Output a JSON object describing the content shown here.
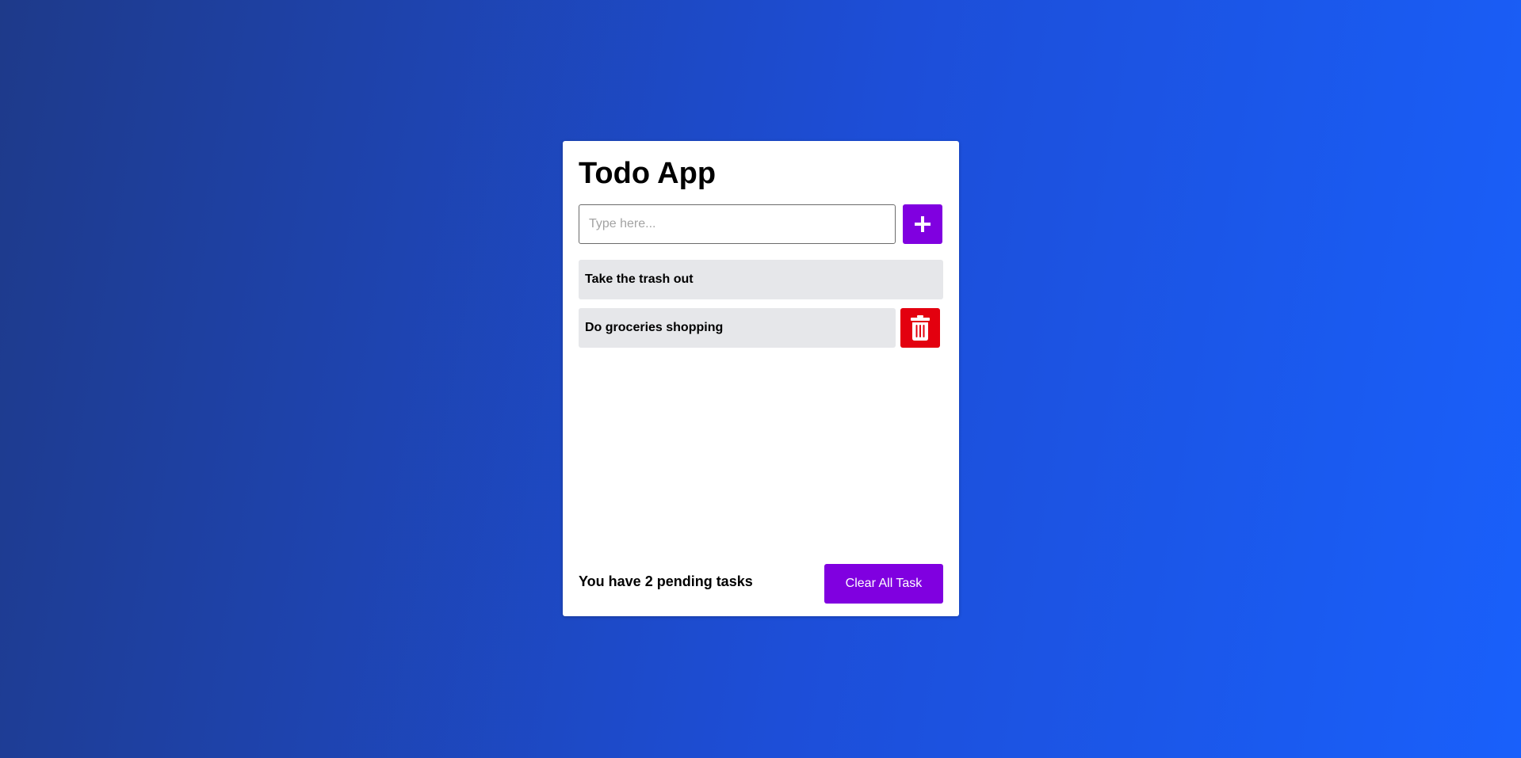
{
  "app": {
    "title": "Todo App"
  },
  "input": {
    "placeholder": "Type here...",
    "value": ""
  },
  "add_button": {
    "icon": "plus-icon"
  },
  "tasks": [
    {
      "text": "Take the trash out",
      "hovered": false
    },
    {
      "text": "Do groceries shopping",
      "hovered": true,
      "action_icon": "trash-icon"
    }
  ],
  "footer": {
    "pending_text": "You have 2 pending tasks",
    "clear_label": "Clear All Task"
  },
  "colors": {
    "accent": "#8000e0",
    "danger": "#e3000f",
    "task_bg": "#e6e7ea",
    "background_start": "#1e3a8a",
    "background_end": "#1960fb"
  }
}
